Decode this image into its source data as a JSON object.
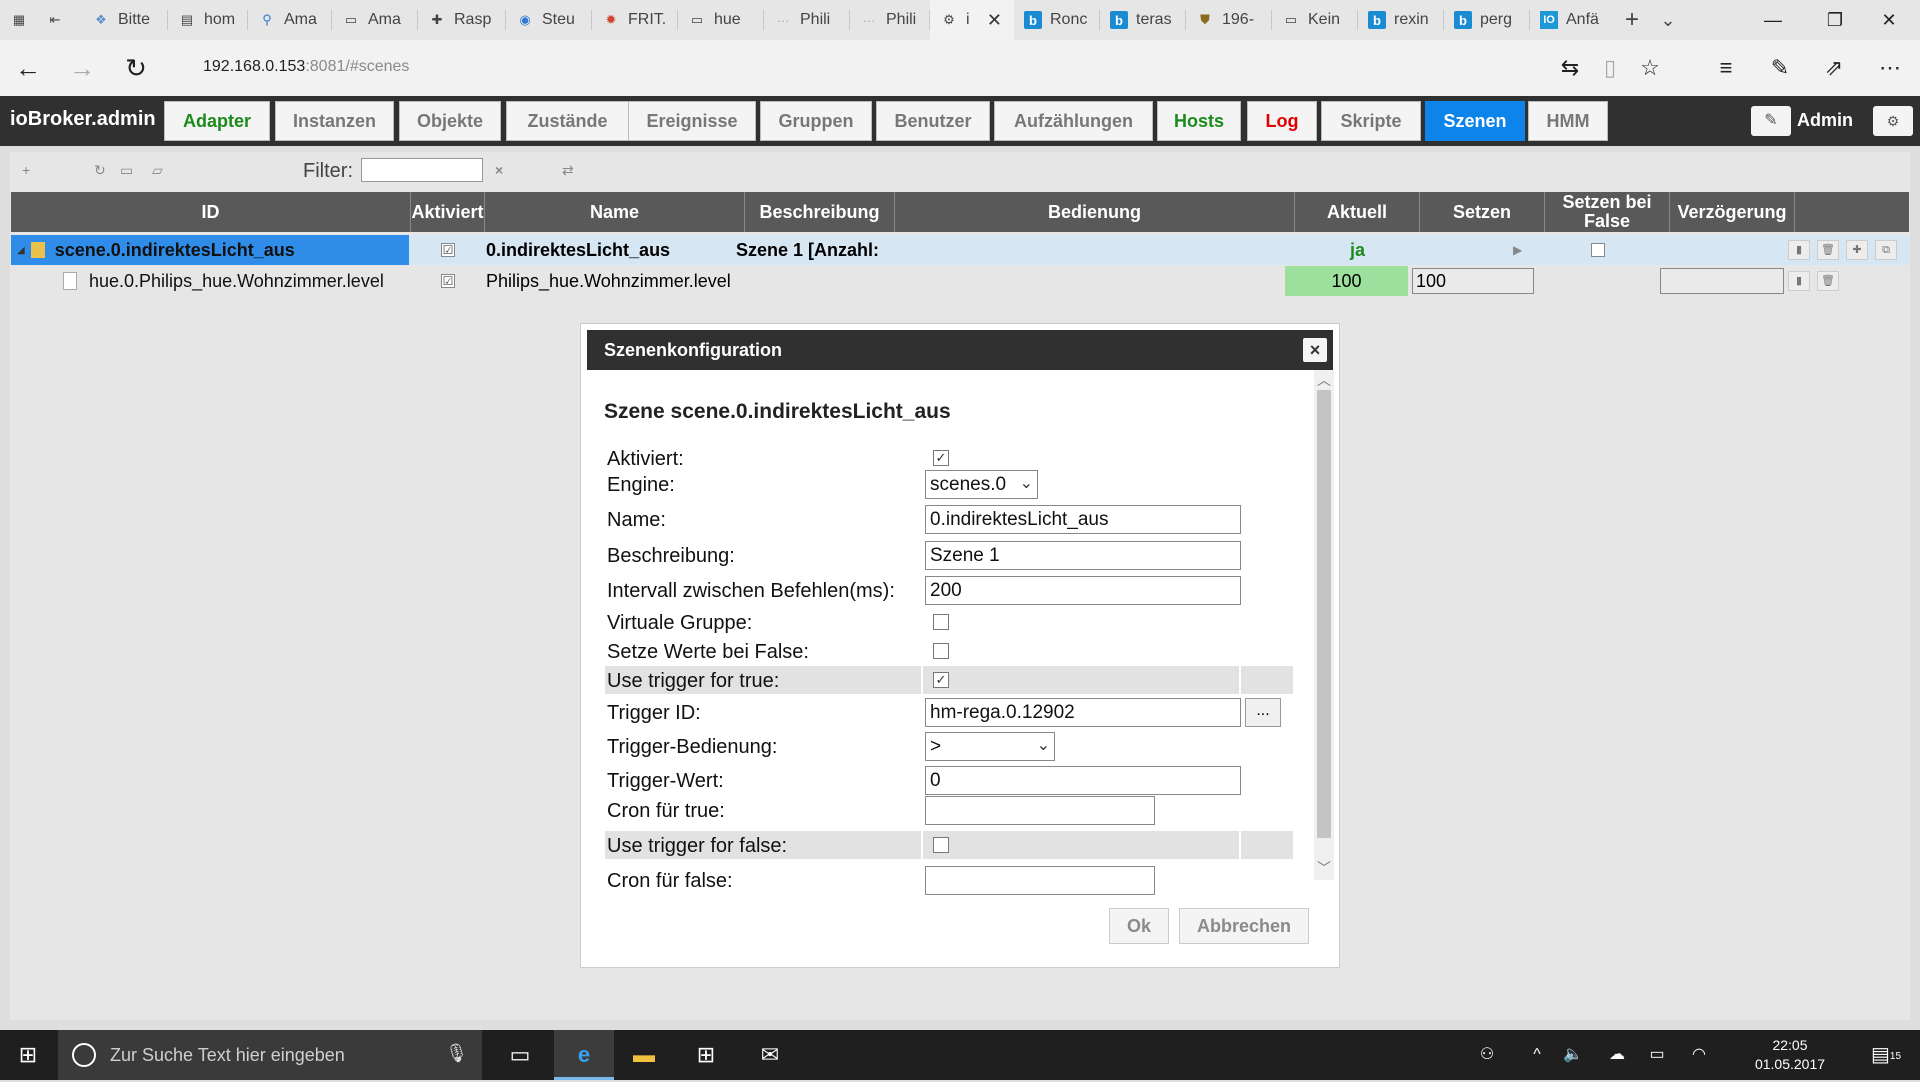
{
  "browser": {
    "tabs": [
      {
        "icon": "▦",
        "label": ""
      },
      {
        "icon": "⇤",
        "label": ""
      },
      {
        "icon": "❖",
        "label": "Bitte"
      },
      {
        "icon": "▤",
        "label": "hom"
      },
      {
        "icon": "⚲",
        "label": "Ama"
      },
      {
        "icon": "▭",
        "label": "Ama"
      },
      {
        "icon": "✚",
        "label": "Rasp"
      },
      {
        "icon": "◉",
        "label": "Steu"
      },
      {
        "icon": "✹",
        "label": "FRIT."
      },
      {
        "icon": "▭",
        "label": "hue"
      },
      {
        "icon": "···",
        "label": "Phili"
      },
      {
        "icon": "···",
        "label": "Phili"
      },
      {
        "icon": "⚙",
        "label": "i"
      },
      {
        "icon": "b",
        "label": "Ronc"
      },
      {
        "icon": "b",
        "label": "teras"
      },
      {
        "icon": "⛊",
        "label": "196-"
      },
      {
        "icon": "▭",
        "label": "Kein"
      },
      {
        "icon": "b",
        "label": "rexin"
      },
      {
        "icon": "b",
        "label": "perg"
      },
      {
        "icon": "IO",
        "label": "Anfä"
      }
    ],
    "new_tab_icon": "+",
    "tab_list_icon": "⌄",
    "window_controls": [
      "—",
      "❐",
      "✕"
    ],
    "url_host": "192.168.0.153",
    "url_rest": ":8081/#scenes"
  },
  "app": {
    "brand": "ioBroker.admin",
    "tabs": [
      {
        "label": "Adapter"
      },
      {
        "label": "Instanzen"
      },
      {
        "label": "Objekte"
      },
      {
        "label": "Zustände"
      },
      {
        "label": "Ereignisse"
      },
      {
        "label": "Gruppen"
      },
      {
        "label": "Benutzer"
      },
      {
        "label": "Aufzählungen"
      },
      {
        "label": "Hosts"
      },
      {
        "label": "Log"
      },
      {
        "label": "Skripte"
      },
      {
        "label": "Szenen"
      },
      {
        "label": "HMM"
      }
    ],
    "user": "Admin",
    "colors": {
      "header": "#303030",
      "active_tab": "#0d84ea",
      "green": "#1c8a1c",
      "red": "#e00000"
    }
  },
  "toolbar": {
    "filter_label": "Filter:",
    "clear_icon": "×"
  },
  "table": {
    "columns": [
      "ID",
      "Aktiviert",
      "Name",
      "Beschreibung",
      "Bedienung",
      "Aktuell",
      "Setzen",
      "Setzen bei False",
      "Verzögerung"
    ],
    "rows": [
      {
        "id": "scene.0.indirektesLicht_aus",
        "activated": "☑",
        "name": "0.indirektesLicht_aus",
        "description": "Szene 1 [Anzahl:",
        "current": "ja"
      },
      {
        "id": "hue.0.Philips_hue.Wohnzimmer.level",
        "activated": "☑",
        "name": "Philips_hue.Wohnzimmer.level",
        "current": "100",
        "set": "100"
      }
    ]
  },
  "dialog": {
    "title": "Szenenkonfiguration",
    "heading": "Szene scene.0.indirektesLicht_aus",
    "fields": {
      "activated": {
        "label": "Aktiviert:",
        "checked": "✓"
      },
      "engine": {
        "label": "Engine:",
        "value": "scenes.0"
      },
      "name": {
        "label": "Name:",
        "value": "0.indirektesLicht_aus"
      },
      "description": {
        "label": "Beschreibung:",
        "value": "Szene 1"
      },
      "interval": {
        "label": "Intervall zwischen Befehlen(ms):",
        "value": "200"
      },
      "virtual_group": {
        "label": "Virtuale Gruppe:"
      },
      "set_on_false": {
        "label": "Setze Werte bei False:"
      },
      "trigger_true": {
        "label": "Use trigger for true:",
        "checked": "✓"
      },
      "trigger_id": {
        "label": "Trigger ID:",
        "value": "hm-rega.0.12902",
        "browse": "..."
      },
      "trigger_op": {
        "label": "Trigger-Bedienung:",
        "value": ">"
      },
      "trigger_value": {
        "label": "Trigger-Wert:",
        "value": "0"
      },
      "cron_true": {
        "label": "Cron für true:",
        "value": ""
      },
      "trigger_false": {
        "label": "Use trigger for false:"
      },
      "cron_false": {
        "label": "Cron für false:"
      }
    },
    "ok": "Ok",
    "cancel": "Abbrechen"
  },
  "taskbar": {
    "search_placeholder": "Zur Suche Text hier eingeben",
    "time": "22:05",
    "date": "01.05.2017",
    "notifications": "15"
  }
}
